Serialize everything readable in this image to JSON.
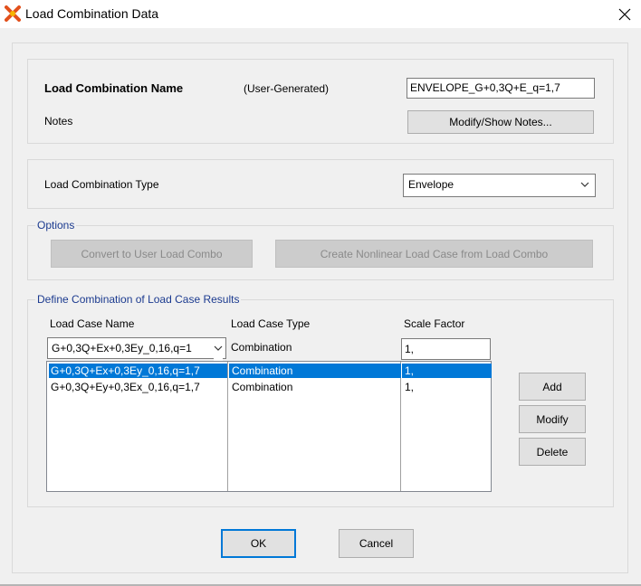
{
  "window": {
    "title": "Load Combination Data"
  },
  "combo": {
    "name_label": "Load Combination Name",
    "name_hint": "(User-Generated)",
    "name_value": "ENVELOPE_G+0,3Q+E_q=1,7",
    "notes_label": "Notes",
    "notes_button": "Modify/Show Notes..."
  },
  "type": {
    "label": "Load Combination Type",
    "value": "Envelope"
  },
  "options": {
    "legend": "Options",
    "convert_button": "Convert to User Load Combo",
    "create_button": "Create Nonlinear Load Case from Load Combo"
  },
  "define": {
    "legend": "Define Combination of Load Case Results",
    "headers": [
      "Load Case Name",
      "Load Case Type",
      "Scale Factor"
    ],
    "editor": {
      "case_name": "G+0,3Q+Ex+0,3Ey_0,16,q=1",
      "case_type": "Combination",
      "scale_factor": "1,"
    },
    "rows": [
      {
        "name": "G+0,3Q+Ex+0,3Ey_0,16,q=1,7",
        "type": "Combination",
        "sf": "1,",
        "selected": true
      },
      {
        "name": "G+0,3Q+Ey+0,3Ex_0,16,q=1,7",
        "type": "Combination",
        "sf": "1,",
        "selected": false
      }
    ],
    "buttons": {
      "add": "Add",
      "modify": "Modify",
      "delete": "Delete"
    }
  },
  "footer": {
    "ok": "OK",
    "cancel": "Cancel"
  },
  "colors": {
    "selection": "#0078d7",
    "legend_text": "#1b3a8f",
    "dialog_bg": "#f0f0f0"
  }
}
